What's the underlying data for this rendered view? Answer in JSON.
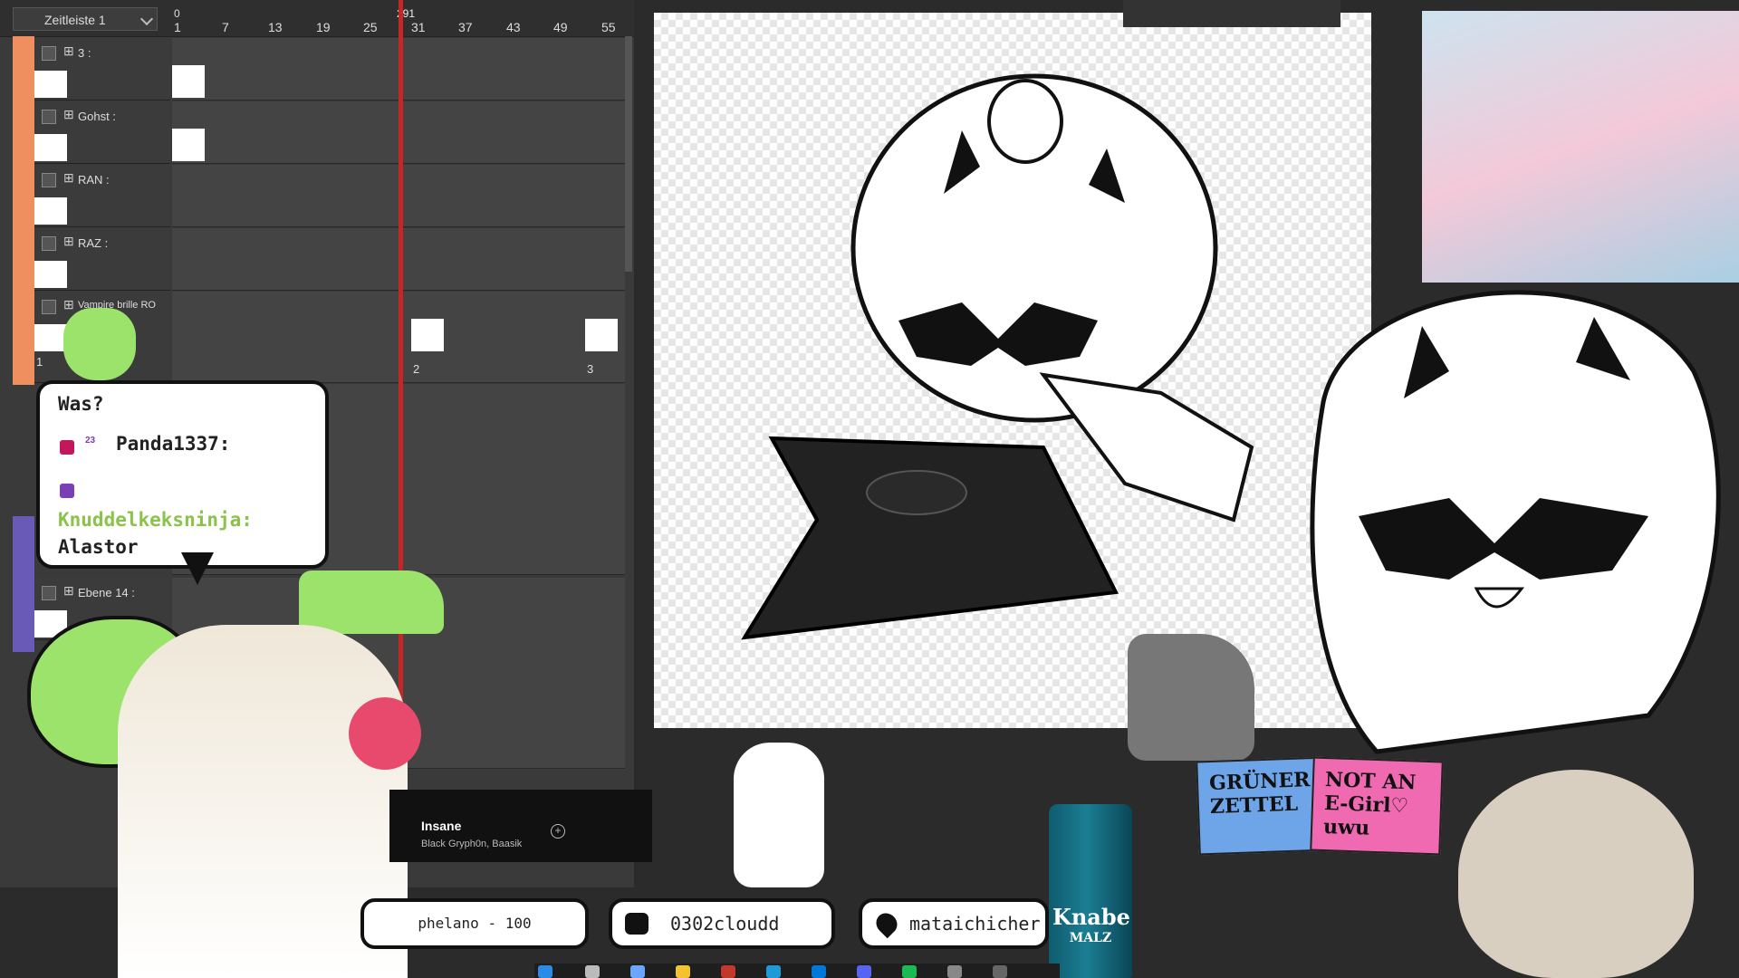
{
  "timeline": {
    "name": "Zeitleiste 1",
    "ruler_top": "0",
    "ticks": [
      "1",
      "7",
      "13",
      "19",
      "25",
      "31",
      "37",
      "43",
      "49",
      "55"
    ],
    "playhead_frame": "291",
    "layers": [
      {
        "name": "3 :"
      },
      {
        "name": "Gohst :"
      },
      {
        "name": "RAN :"
      },
      {
        "name": "RAZ :"
      },
      {
        "name": "Vampire brille RO"
      },
      {
        "name": "Ebene 14 :"
      }
    ],
    "frame_numbers": [
      "1",
      "2",
      "3"
    ]
  },
  "chat": {
    "message1": "Was?",
    "user1": "Panda1337:",
    "badge_num": "23",
    "user2": "Knuddelkeksninja:",
    "message2": "Alastor"
  },
  "music": {
    "title": "Insane",
    "artist": "Black Gryph0n, Baasik"
  },
  "tags": {
    "tag1": "phelano - 100",
    "tag2": "0302cloudd",
    "tag3": "mataichicher"
  },
  "notes": {
    "note1": "GRÜNER ZETTEL",
    "note2": "NOT AN E-Girl♡ uwu"
  },
  "can": {
    "brand": "Knabe",
    "sub": "MALZ"
  },
  "colors": {
    "playhead": "#c72626",
    "layer_accent": "#ef8e5f",
    "note_blue": "#6ea4e8",
    "note_pink": "#f06ab1",
    "chat_green": "#8bc34a"
  }
}
